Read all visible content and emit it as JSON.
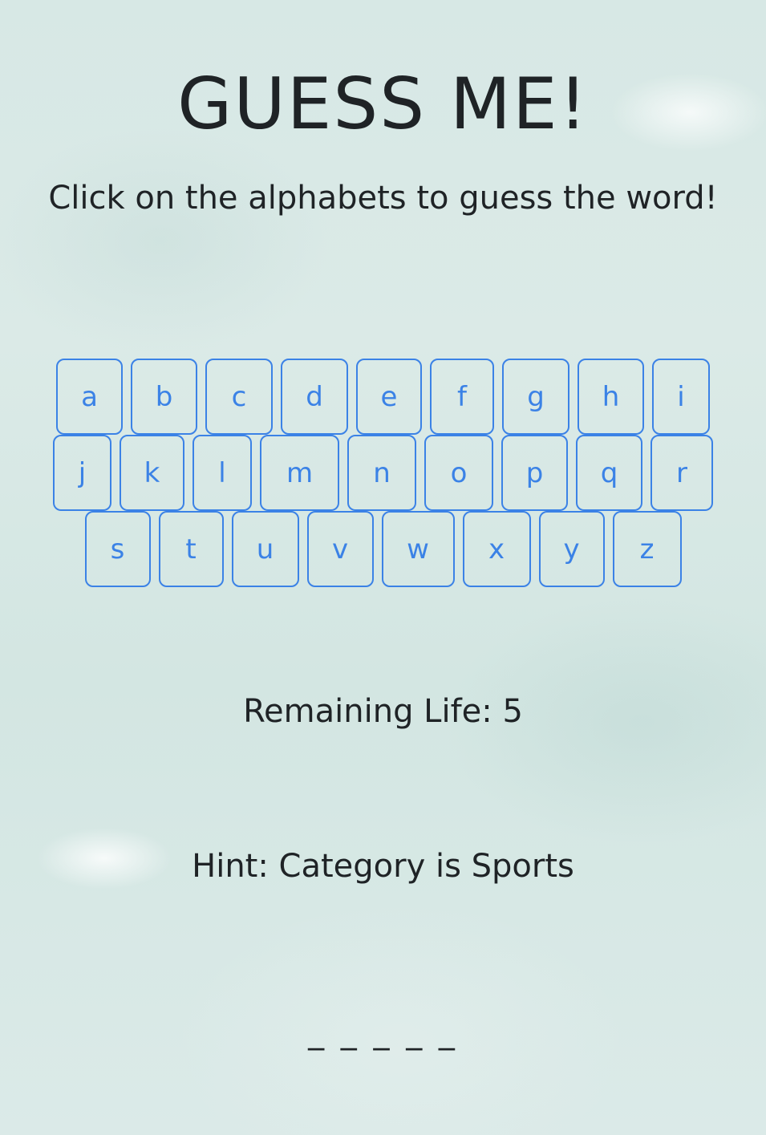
{
  "game": {
    "title": "GUESS ME!",
    "instruction": "Click on the alphabets to guess the word!",
    "remaining_life_label": "Remaining Life: 5",
    "hint": "Hint: Category is Sports",
    "word_blanks": "_ _ _ _ _"
  },
  "keyboard": {
    "rows": [
      [
        "a",
        "b",
        "c",
        "d",
        "e",
        "f",
        "g",
        "h",
        "i"
      ],
      [
        "j",
        "k",
        "l",
        "m",
        "n",
        "o",
        "p",
        "q",
        "r"
      ],
      [
        "s",
        "t",
        "u",
        "v",
        "w",
        "x",
        "y",
        "z"
      ]
    ]
  },
  "colors": {
    "key_accent": "#3b82e6",
    "text": "#1f2326",
    "background": "#d7e8e5"
  }
}
